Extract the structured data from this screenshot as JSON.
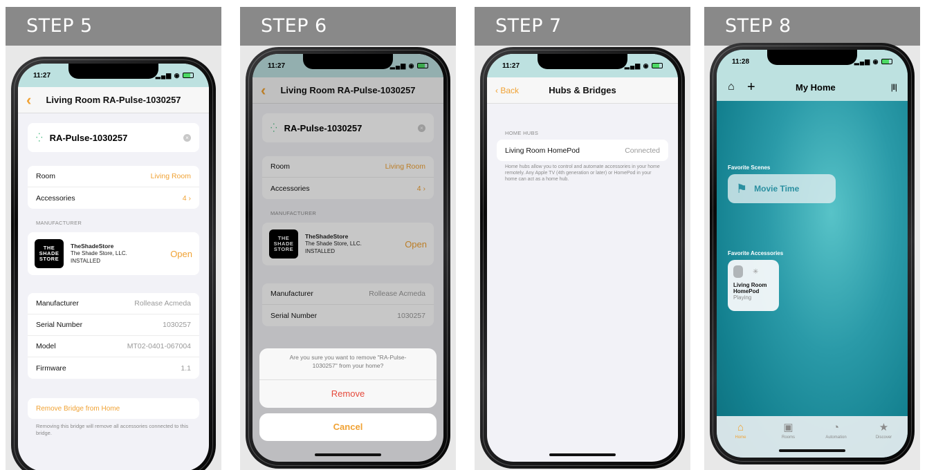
{
  "steps": {
    "s5": "STEP 5",
    "s6": "STEP 6",
    "s7": "STEP 7",
    "s8": "STEP 8"
  },
  "status": {
    "time_a": "11:27",
    "time_b": "11:28"
  },
  "detail": {
    "nav_title": "Living Room RA-Pulse-1030257",
    "device_name": "RA-Pulse-1030257",
    "room_label": "Room",
    "room_value": "Living Room",
    "accessories_label": "Accessories",
    "accessories_value": "4",
    "manufacturer_section": "MANUFACTURER",
    "logo_line1": "THE",
    "logo_line2": "SHADE",
    "logo_line3": "STORE",
    "app_name": "TheShadeStore",
    "company": "The Shade Store, LLC.",
    "installed": "INSTALLED",
    "open": "Open",
    "manufacturer_label": "Manufacturer",
    "manufacturer_value": "Rollease Acmeda",
    "serial_label": "Serial Number",
    "serial_value": "1030257",
    "model_label": "Model",
    "model_value": "MT02-0401-067004",
    "firmware_label": "Firmware",
    "firmware_value": "1.1",
    "remove_bridge": "Remove Bridge from Home",
    "remove_note": "Removing this bridge will remove all accessories connected to this bridge."
  },
  "sheet": {
    "question": "Are you sure you want to remove \"RA-Pulse-1030257\" from your home?",
    "remove": "Remove",
    "cancel": "Cancel"
  },
  "hubs": {
    "back": "Back",
    "title": "Hubs & Bridges",
    "section": "HOME HUBS",
    "hub_name": "Living Room HomePod",
    "hub_status": "Connected",
    "note": "Home hubs allow you to control and automate accessories in your home remotely. Any Apple TV (4th generation or later) or HomePod in your home can act as a home hub."
  },
  "home": {
    "title": "My Home",
    "fav_scenes": "Favorite Scenes",
    "scene_name": "Movie Time",
    "fav_accessories": "Favorite Accessories",
    "acc_name_1": "Living Room",
    "acc_name_2": "HomePod",
    "acc_state": "Playing",
    "tabs": [
      "Home",
      "Rooms",
      "Automation",
      "Discover"
    ]
  },
  "colors": {
    "accent": "#f0a234",
    "header_bg": "#898989",
    "teal": "#2a9aa8"
  }
}
